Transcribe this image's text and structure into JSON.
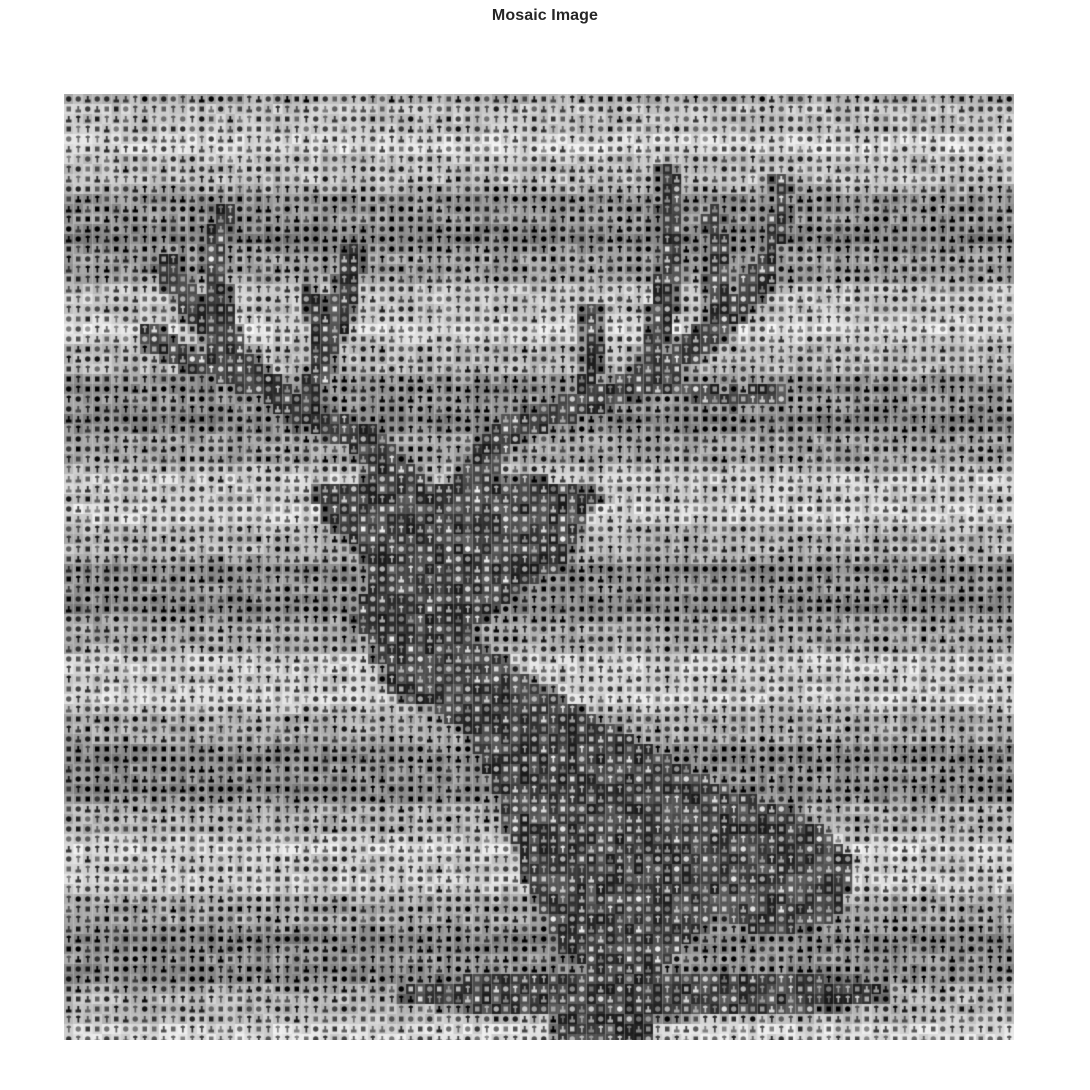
{
  "figure": {
    "title": "Mosaic Image"
  },
  "image": {
    "subject": "stag-head-mosaic",
    "palette": "grayscale"
  }
}
